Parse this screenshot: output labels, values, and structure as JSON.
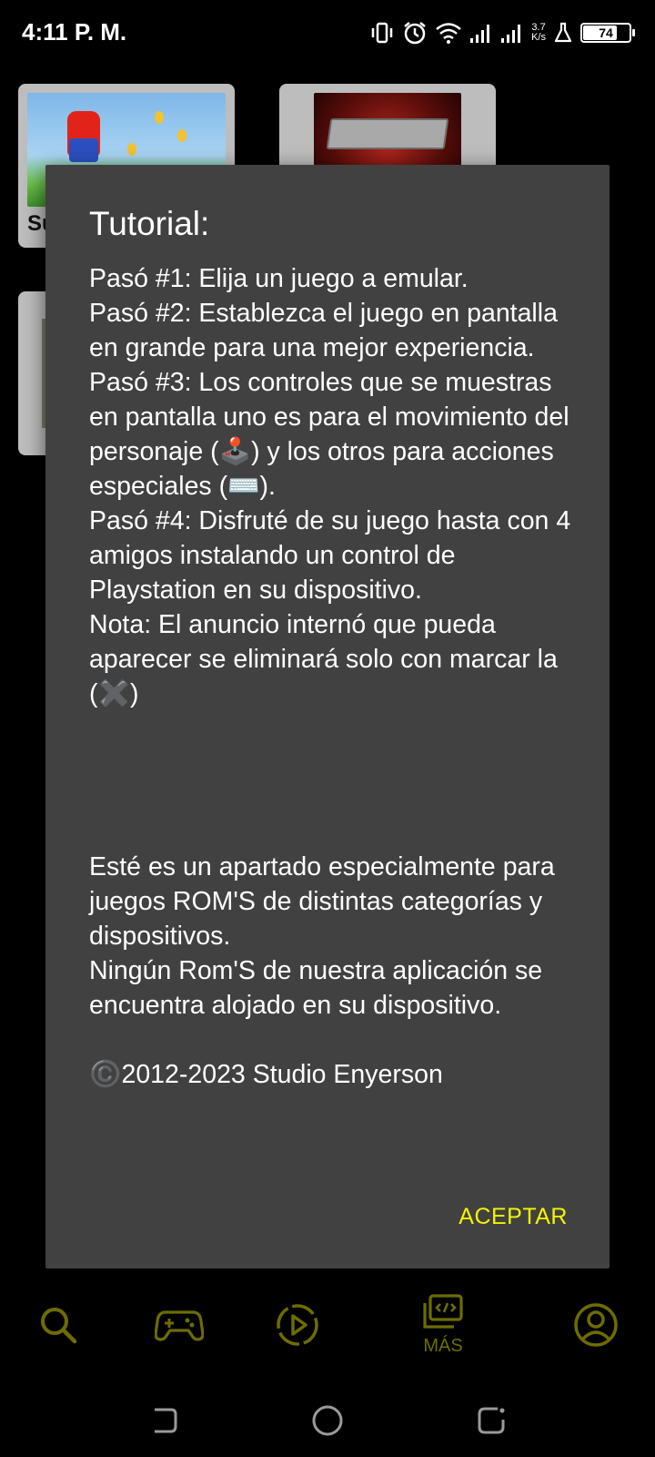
{
  "status_bar": {
    "time": "4:11 P. M.",
    "net_speed_value": "3.7",
    "net_speed_unit": "K/s",
    "battery": "74",
    "icons": [
      "vibrate-icon",
      "alarm-icon",
      "wifi-icon",
      "signal-icon",
      "signal-icon",
      "flask-icon",
      "battery-icon"
    ]
  },
  "background": {
    "cards": [
      {
        "label": "Su",
        "thumb": "super-mario-thumbnail"
      },
      {
        "label": "",
        "thumb": "tekken-3-thumbnail"
      },
      {
        "label": "",
        "thumb": "game-thumbnail"
      }
    ]
  },
  "dialog": {
    "title": "Tutorial:",
    "steps": [
      "Pasó #1: Elija un juego a emular.",
      "Pasó #2: Establezca el juego en pantalla en grande para una mejor experiencia.",
      "Pasó #3: Los controles que se muestras en pantalla uno es para el movimiento del personaje (🕹️) y los otros para acciones especiales (⌨️).",
      "Pasó #4: Disfruté de su juego hasta con 4 amigos instalando un control de Playstation en su dispositivo.",
      "Nota: El anuncio internó que pueda aparecer se eliminará solo con marcar la (✖️)"
    ],
    "info": [
      "Esté es un apartado especialmente para juegos ROM'S de distintas categorías y dispositivos.",
      "Ningún Rom'S de nuestra aplicación se encuentra alojado en su dispositivo."
    ],
    "copyright": "©️2012-2023 Studio Enyerson",
    "accept_label": "ACEPTAR"
  },
  "bottom_nav": {
    "items": [
      {
        "icon": "search-icon",
        "label": ""
      },
      {
        "icon": "gamepad-icon",
        "label": ""
      },
      {
        "icon": "play-icon",
        "label": ""
      },
      {
        "icon": "code-laptop-icon",
        "label": "MÁS"
      },
      {
        "icon": "account-icon",
        "label": ""
      }
    ],
    "accent_color": "#6d6d00"
  },
  "colors": {
    "dialog_bg": "#414141",
    "accent": "#f4f400",
    "background": "#000000"
  }
}
